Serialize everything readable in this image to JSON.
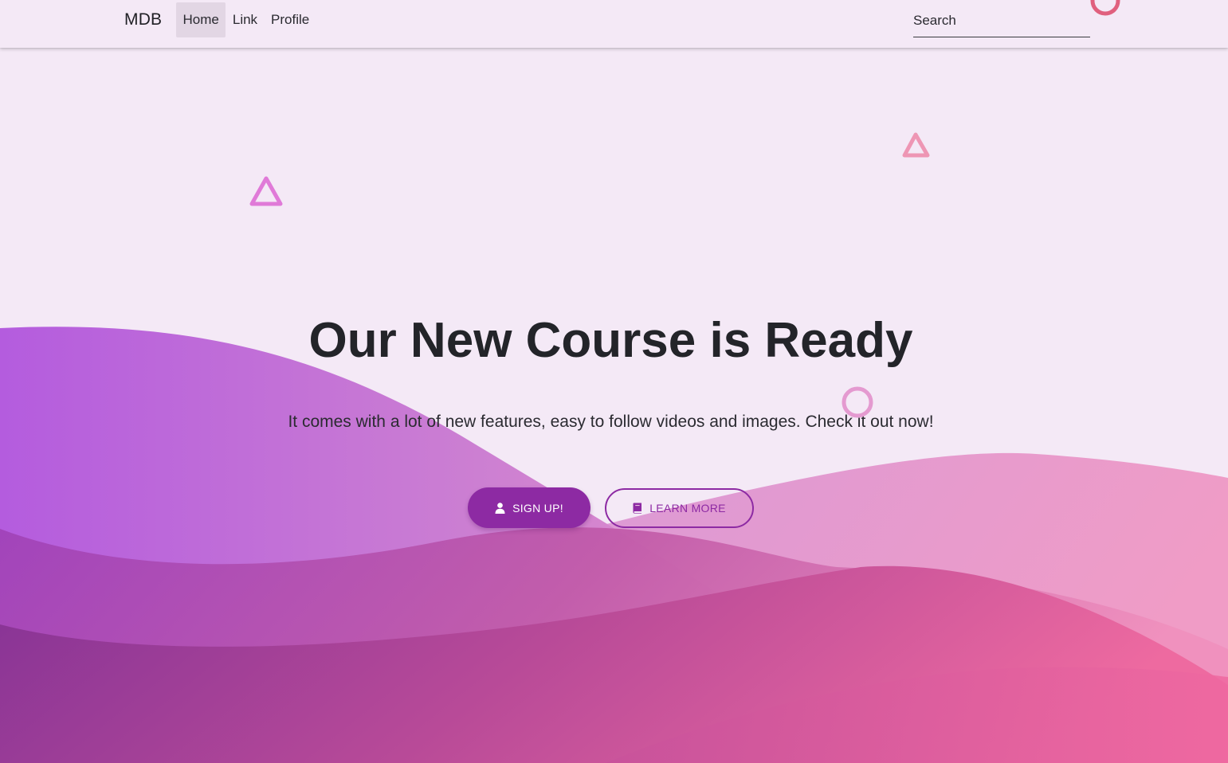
{
  "navbar": {
    "brand": "MDB",
    "links": [
      {
        "label": "Home",
        "active": true
      },
      {
        "label": "Link",
        "active": false
      },
      {
        "label": "Profile",
        "active": false
      }
    ],
    "search": {
      "placeholder": "Search",
      "value": ""
    }
  },
  "hero": {
    "title": "Our New Course is Ready",
    "subtitle": "It comes with a lot of new features, easy to follow videos and images. Check it out now!",
    "primary_button": {
      "label": "SIGN UP!",
      "icon": "user-icon"
    },
    "secondary_button": {
      "label": "LEARN MORE",
      "icon": "book-icon"
    }
  },
  "colors": {
    "background": "#f4e9f6",
    "accent": "#8d2aa3",
    "text": "#232429",
    "wave_purple": "#b562de",
    "wave_pink": "#ef6aa0"
  }
}
